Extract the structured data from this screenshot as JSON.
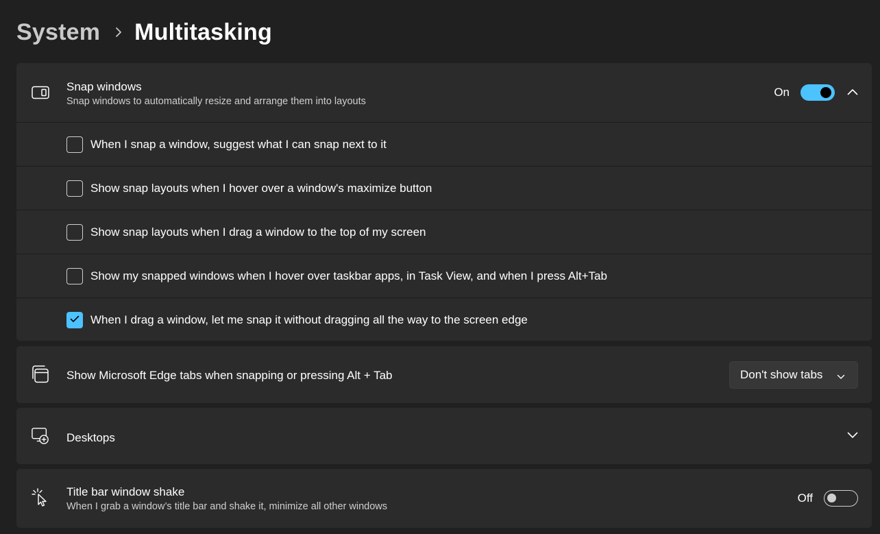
{
  "breadcrumb": {
    "parent": "System",
    "current": "Multitasking"
  },
  "snap_windows": {
    "title": "Snap windows",
    "description": "Snap windows to automatically resize and arrange them into layouts",
    "state_label": "On",
    "enabled": true,
    "options": [
      {
        "label": "When I snap a window, suggest what I can snap next to it",
        "checked": false
      },
      {
        "label": "Show snap layouts when I hover over a window's maximize button",
        "checked": false
      },
      {
        "label": "Show snap layouts when I drag a window to the top of my screen",
        "checked": false
      },
      {
        "label": "Show my snapped windows when I hover over taskbar apps, in Task View, and when I press Alt+Tab",
        "checked": false
      },
      {
        "label": "When I drag a window, let me snap it without dragging all the way to the screen edge",
        "checked": true
      }
    ]
  },
  "edge_tabs": {
    "title": "Show Microsoft Edge tabs when snapping or pressing Alt + Tab",
    "selected": "Don't show tabs"
  },
  "desktops": {
    "title": "Desktops"
  },
  "title_bar_shake": {
    "title": "Title bar window shake",
    "description": "When I grab a window’s title bar and shake it, minimize all other windows",
    "state_label": "Off",
    "enabled": false
  },
  "colors": {
    "background": "#202020",
    "card": "#2b2b2b",
    "accent": "#4cc2ff"
  },
  "icons": {
    "snap_windows": "snap-windows-icon",
    "edge_tabs": "edge-tabs-icon",
    "desktops": "desktops-icon",
    "title_bar_shake": "window-shake-icon"
  }
}
